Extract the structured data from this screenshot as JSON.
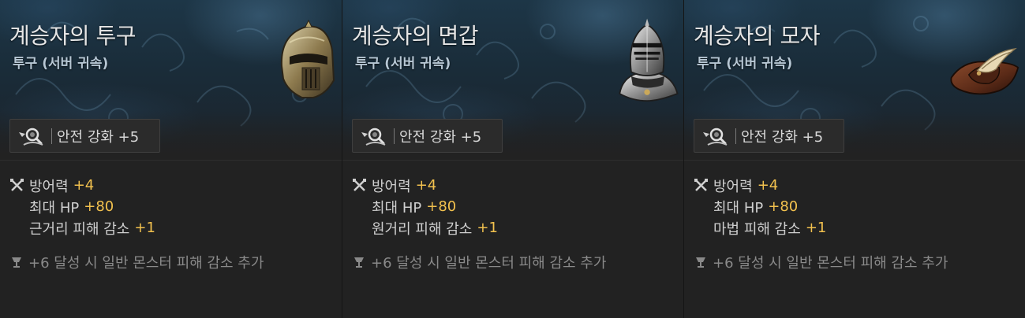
{
  "cards": [
    {
      "title": "계승자의 투구",
      "subtitle": "투구 (서버 귀속)",
      "item_icon": "helmet-icon",
      "safe_upgrade_label": "안전 강화 +5",
      "stats": [
        {
          "name": "방어력",
          "value": "+4"
        },
        {
          "name": "최대 HP",
          "value": "+80"
        },
        {
          "name": "근거리 피해 감소",
          "value": "+1"
        }
      ],
      "bonus": "+6 달성 시 일반 몬스터 피해 감소 추가"
    },
    {
      "title": "계승자의 면갑",
      "subtitle": "투구 (서버 귀속)",
      "item_icon": "visor-helm-icon",
      "safe_upgrade_label": "안전 강화 +5",
      "stats": [
        {
          "name": "방어력",
          "value": "+4"
        },
        {
          "name": "최대 HP",
          "value": "+80"
        },
        {
          "name": "원거리 피해 감소",
          "value": "+1"
        }
      ],
      "bonus": "+6 달성 시 일반 몬스터 피해 감소 추가"
    },
    {
      "title": "계승자의 모자",
      "subtitle": "투구 (서버 귀속)",
      "item_icon": "feathered-hat-icon",
      "safe_upgrade_label": "안전 강화 +5",
      "stats": [
        {
          "name": "방어력",
          "value": "+4"
        },
        {
          "name": "최대 HP",
          "value": "+80"
        },
        {
          "name": "마법 피해 감소",
          "value": "+1"
        }
      ],
      "bonus": "+6 달성 시 일반 몬스터 피해 감소 추가"
    }
  ],
  "colors": {
    "stat_value": "#f2c14e",
    "stat_name": "#cfcfcf",
    "bonus_text": "#8a8a8a",
    "subtitle": "#b7c7d4"
  }
}
